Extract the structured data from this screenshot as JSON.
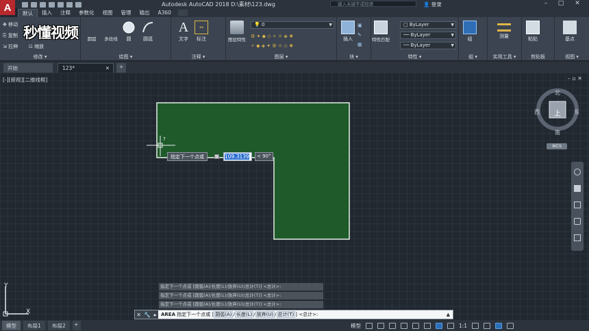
{
  "titlebar": {
    "logo": "A",
    "title": "Autodesk AutoCAD 2018    D:\\素材\\123.dwg",
    "search_placeholder": "键入关键字或短语",
    "login": "登录"
  },
  "ribbon_tabs": [
    "默认",
    "插入",
    "注释",
    "参数化",
    "视图",
    "管理",
    "输出",
    "A360"
  ],
  "ribbon": {
    "modify": {
      "label": "修改 ▾",
      "items": [
        "移动",
        "复制",
        "拉伸",
        "缩放"
      ],
      "big": [
        "圆弧",
        "多段线"
      ]
    },
    "draw": {
      "label": "绘图 ▾",
      "items": [
        "圆",
        "圆弧"
      ]
    },
    "annotation": {
      "label": "注释 ▾",
      "items": [
        "文字",
        "标注"
      ]
    },
    "layers": {
      "label": "图层 ▾",
      "layer_value": "0",
      "btn": "图层特性"
    },
    "block": {
      "label": "块 ▾",
      "btn": "插入"
    },
    "properties": {
      "label": "特性 ▾",
      "btn": "特性匹配",
      "color": "ByLayer",
      "linetype": "ByLayer",
      "lineweight": "ByLayer"
    },
    "groups": {
      "label": "组 ▾",
      "btn": "组"
    },
    "utilities": {
      "label": "实用工具 ▾",
      "btn": "测量"
    },
    "clipboard": {
      "label": "剪贴板",
      "btn": "粘贴"
    },
    "view": {
      "label": "视图 ▾",
      "btn": "基点"
    }
  },
  "watermark": "秒懂视频",
  "doc_tabs": {
    "start": "开始",
    "doc": "123*",
    "add": "+"
  },
  "viewport": {
    "label": "[-][俯视][二维线框]"
  },
  "viewcube": {
    "north": "北",
    "south": "南",
    "east": "东",
    "west": "西",
    "face": "上",
    "wcs": "WCS"
  },
  "dynamic_input": {
    "prompt": "指定下一个点或",
    "length": "109.3139",
    "angle": "< 90°",
    "question": "?"
  },
  "ucs": {
    "x": "X",
    "y": "Y"
  },
  "command_history": [
    "指定下一个点或 [圆弧(A)/长度(L)/放弃(U)/总计(T)] <总计>:",
    "指定下一个点或 [圆弧(A)/长度(L)/放弃(U)/总计(T)] <总计>:",
    "指定下一个点或 [圆弧(A)/长度(L)/放弃(U)/总计(T)] <总计>:"
  ],
  "command_line": {
    "cmd": "AREA",
    "prompt": "指定下一个点或 [",
    "opt1": "圆弧(A)",
    "opt2": "长度(L)",
    "opt3": "放弃(U)",
    "opt4": "总计(T)",
    "tail": "] <总计>:"
  },
  "status": {
    "model": "模型",
    "layout1": "布局1",
    "layout2": "布局2",
    "add": "+",
    "model_space": "模型",
    "scale": "1:1"
  },
  "colors": {
    "shape_fill": "#1e5a2a",
    "shape_stroke": "#e6f0e6",
    "accent": "#2b6fcf"
  }
}
